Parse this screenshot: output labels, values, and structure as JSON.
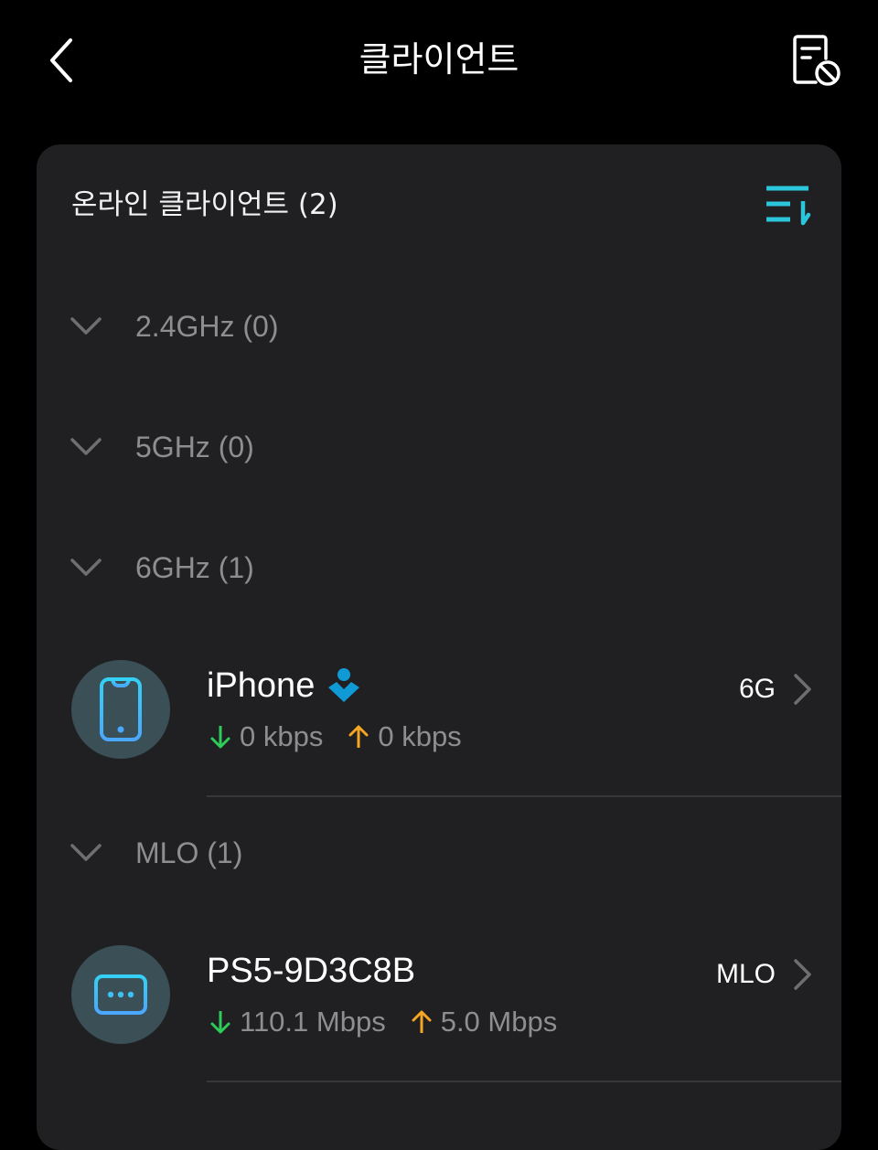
{
  "header": {
    "title": "클라이언트",
    "back_icon": "chevron-left-icon",
    "action_icon": "blocklist-icon"
  },
  "online_clients": {
    "title": "온라인 클라이언트 (2)",
    "sort_icon": "sort-icon",
    "accent_color": "#2bc6dc",
    "groups": [
      {
        "label": "2.4GHz (0)"
      },
      {
        "label": "5GHz (0)"
      },
      {
        "label": "6GHz (1)"
      },
      {
        "label": "MLO (1)"
      }
    ],
    "clients": [
      {
        "name": "iPhone",
        "device_icon": "smartphone-icon",
        "badge_icon": "owner-badge-icon",
        "download": "0 kbps",
        "upload": "0 kbps",
        "band": "6G"
      },
      {
        "name": "PS5-9D3C8B",
        "device_icon": "game-console-icon",
        "download": "110.1 Mbps",
        "upload": "5.0 Mbps",
        "band": "MLO"
      }
    ],
    "colors": {
      "download": "#2ecc59",
      "upload": "#f5a623",
      "icon_blue": "#3fb8f5",
      "badge_blue": "#0f9ad6"
    }
  }
}
